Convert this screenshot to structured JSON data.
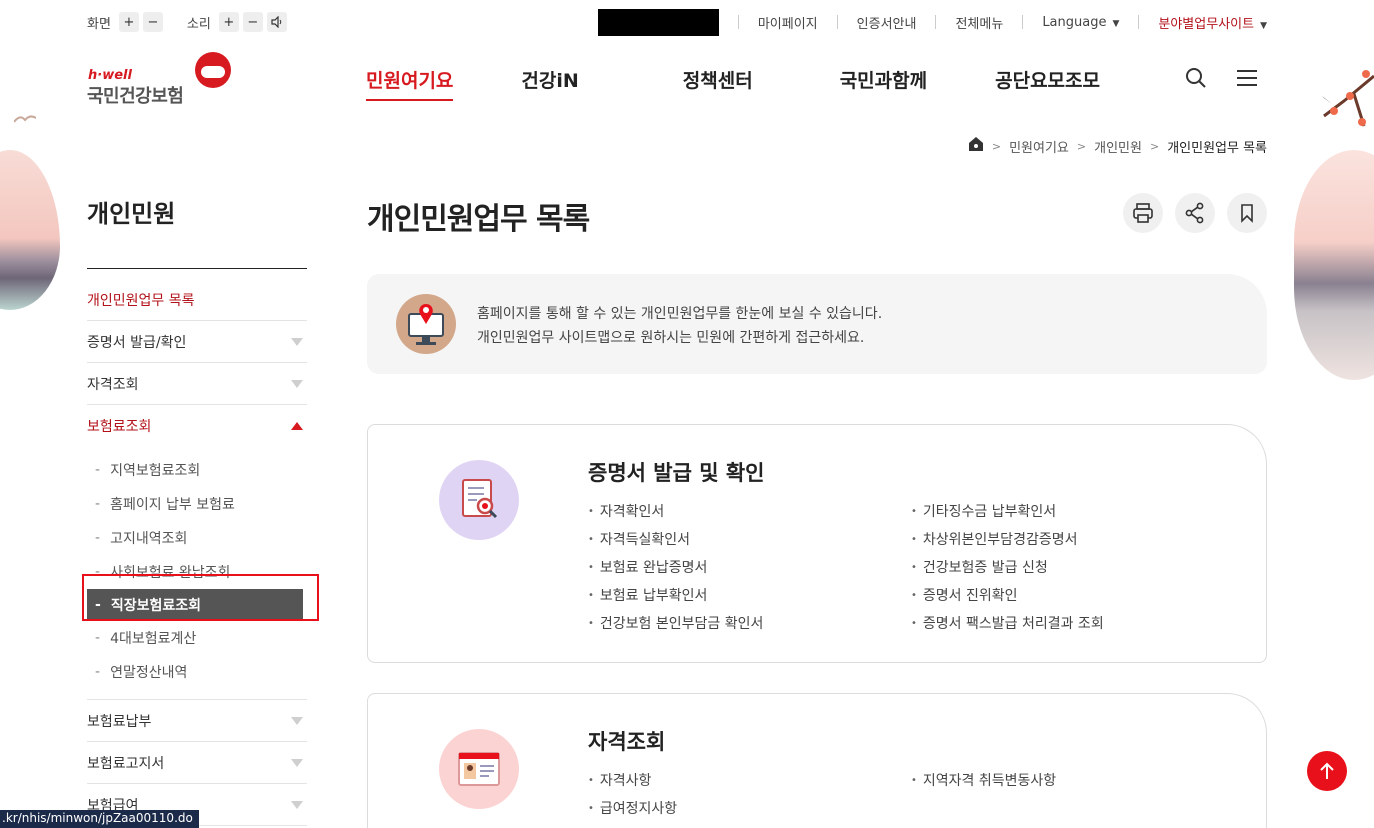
{
  "utility": {
    "screen_label": "화면",
    "sound_label": "소리",
    "plus": "+",
    "minus": "−",
    "links": [
      "마이페이지",
      "인증서안내",
      "전체메뉴"
    ],
    "language": "Language",
    "field_sites": "분야별업무사이트"
  },
  "logo": {
    "tagline": "h·well",
    "name": "국민건강보험"
  },
  "gnb": [
    {
      "label": "민원여기요",
      "active": true
    },
    {
      "label": "건강iN"
    },
    {
      "label": "정책센터"
    },
    {
      "label": "국민과함께"
    },
    {
      "label": "공단요모조모"
    }
  ],
  "breadcrumb": [
    "민원여기요",
    "개인민원",
    "개인민원업무 목록"
  ],
  "sidebar": {
    "title": "개인민원",
    "items": [
      {
        "label": "개인민원업무 목록"
      },
      {
        "label": "증명서 발급/확인"
      },
      {
        "label": "자격조회"
      },
      {
        "label": "보험료조회"
      },
      {
        "label": "보험료납부"
      },
      {
        "label": "보험료고지서"
      },
      {
        "label": "보험급여"
      }
    ],
    "subitems": [
      "지역보험료조회",
      "홈페이지 납부 보험료",
      "고지내역조회",
      "사회보험료 완납조회",
      "직장보험료조회",
      "4대보험료계산",
      "연말정산내역"
    ],
    "dash": "-"
  },
  "page": {
    "title": "개인민원업무 목록"
  },
  "intro": {
    "line1": "홈페이지를 통해 할 수 있는 개인민원업무를 한눈에 보실 수 있습니다.",
    "line2": "개인민원업무 사이트맵으로 원하시는 민원에 간편하게 접근하세요."
  },
  "cards": [
    {
      "title": "증명서 발급 및 확인",
      "left": [
        "자격확인서",
        "자격득실확인서",
        "보험료 완납증명서",
        "보험료 납부확인서",
        "건강보험 본인부담금 확인서"
      ],
      "right": [
        "기타징수금 납부확인서",
        "차상위본인부담경감증명서",
        "건강보험증 발급 신청",
        "증명서 진위확인",
        "증명서 팩스발급 처리결과 조회"
      ]
    },
    {
      "title": "자격조회",
      "left": [
        "자격사항",
        "급여정지사항"
      ],
      "right": [
        "지역자격 취득변동사항"
      ]
    }
  ],
  "bullet": "•",
  "status_url": ".kr/nhis/minwon/jpZaa00110.do",
  "colors": {
    "brand_red": "#d71920",
    "active_sub_bg": "#555555"
  }
}
